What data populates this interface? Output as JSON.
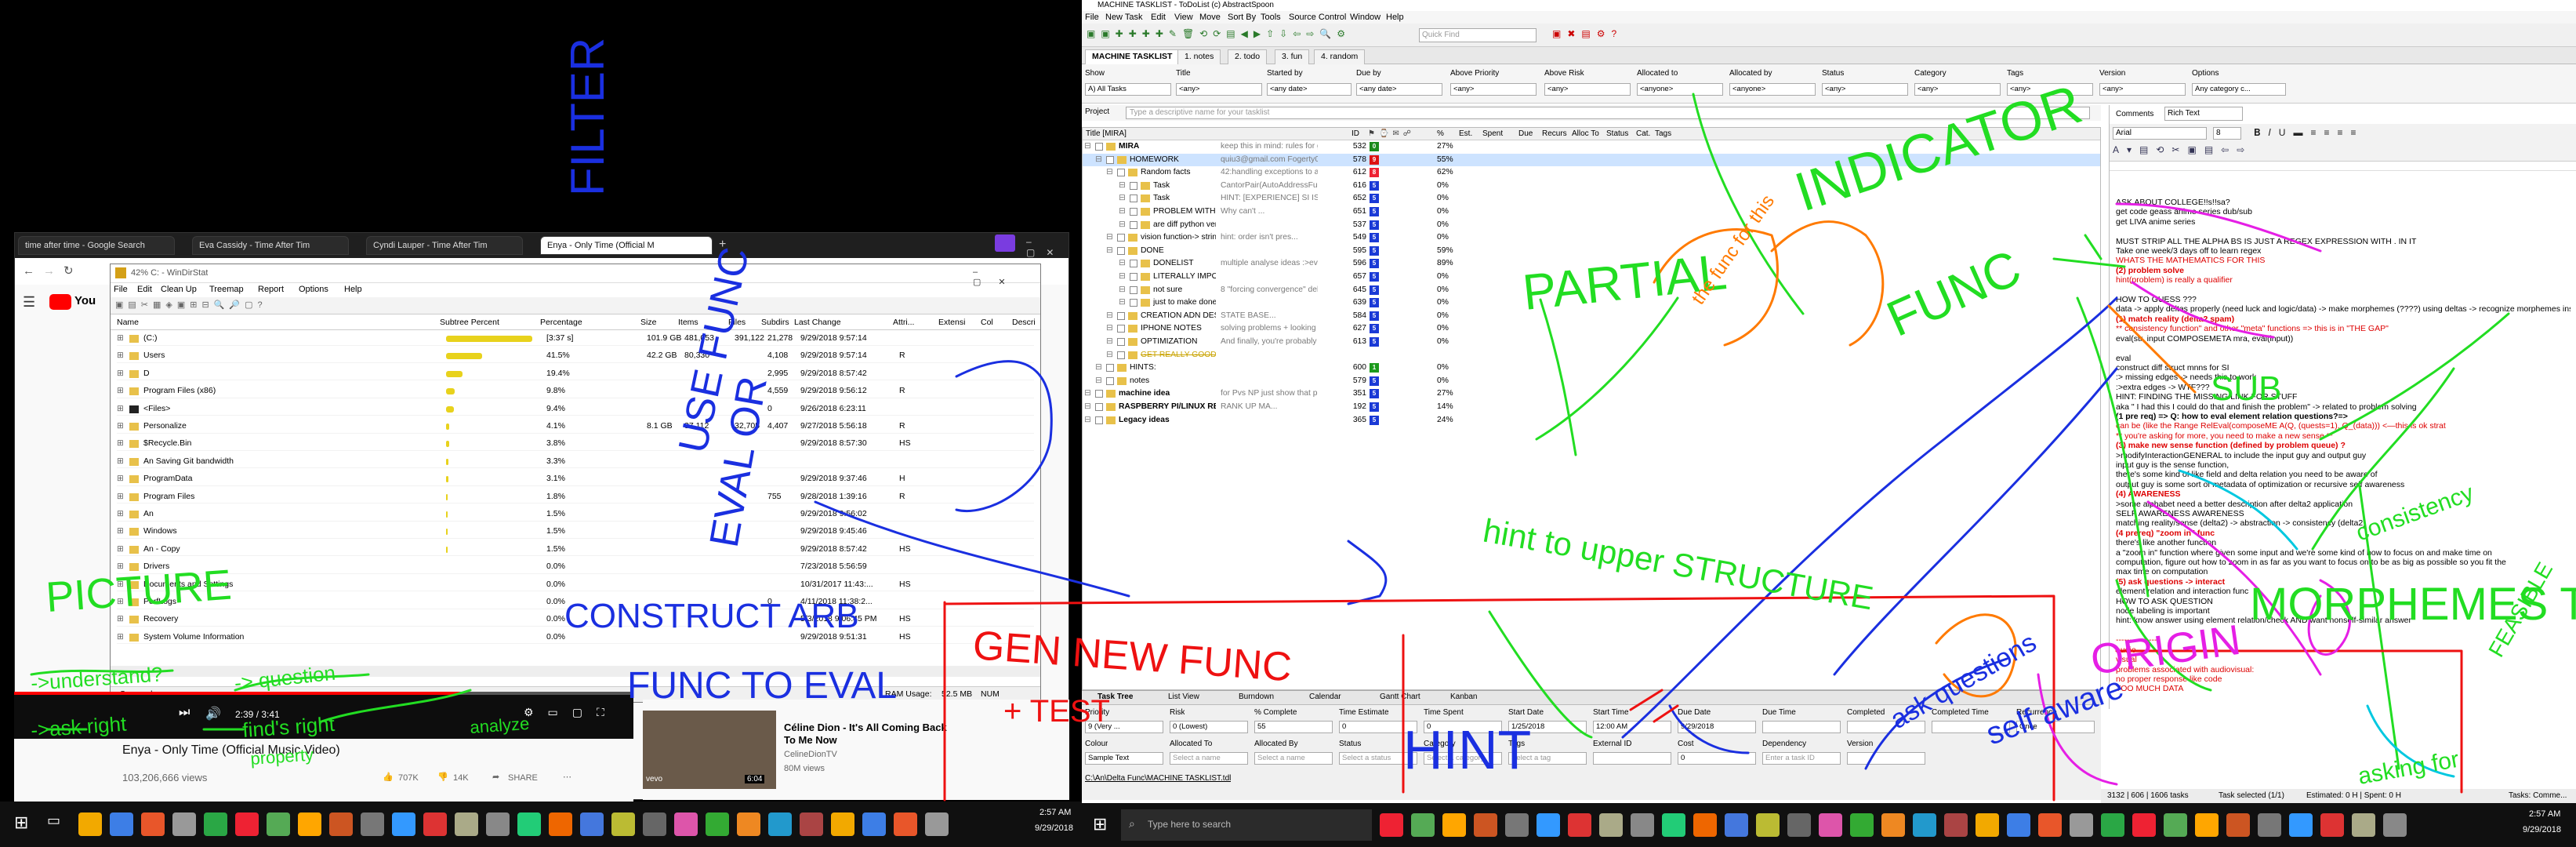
{
  "browser": {
    "tabs": [
      "time after time - Google Search",
      "Eva Cassidy - Time After Tim",
      "Cyndi Lauper - Time After Tim",
      "Enya - Only Time (Official M"
    ],
    "new_tab": "+"
  },
  "windirstat": {
    "title": "42% C: - WinDirStat",
    "menu": [
      "File",
      "Edit",
      "Clean Up",
      "Treemap",
      "Report",
      "Options",
      "Help"
    ],
    "columns": [
      "Name",
      "Subtree Percent",
      "Percentage",
      "Size",
      "Items",
      "Files",
      "Subdirs",
      "Last Change",
      "Attri...",
      "Extensi",
      "Col",
      "Descri"
    ],
    "rows": [
      {
        "name": "(C:)",
        "pct": "[3:37 s]",
        "size": "101.9 GB",
        "items": "481,053",
        "files": "391,122",
        "subdirs": "21,278",
        "change": "9/29/2018 9:57:14",
        "attr": ""
      },
      {
        "name": "Users",
        "pct": "41.5%",
        "size": "42.2 GB",
        "items": "80,330",
        "files": "",
        "subdirs": "4,108",
        "change": "9/29/2018 9:57:14",
        "attr": "R"
      },
      {
        "name": "D",
        "pct": "19.4%",
        "size": "",
        "items": "",
        "files": "",
        "subdirs": "2,995",
        "change": "9/29/2018 8:57:42",
        "attr": ""
      },
      {
        "name": "Program Files (x86)",
        "pct": "9.8%",
        "size": "",
        "items": "",
        "files": "",
        "subdirs": "4,559",
        "change": "9/29/2018 9:56:12",
        "attr": "R"
      },
      {
        "name": "<Files>",
        "pct": "9.4%",
        "size": "",
        "items": "",
        "files": "",
        "subdirs": "0",
        "change": "9/26/2018 6:23:11",
        "attr": ""
      },
      {
        "name": "Personalize",
        "pct": "4.1%",
        "size": "8.1 GB",
        "items": "37,112",
        "files": "32,705",
        "subdirs": "4,407",
        "change": "9/27/2018 5:56:18",
        "attr": "R"
      },
      {
        "name": "$Recycle.Bin",
        "pct": "3.8%",
        "size": "",
        "items": "",
        "files": "",
        "subdirs": "",
        "change": "9/29/2018 8:57:30",
        "attr": "HS"
      },
      {
        "name": "An Saving Git bandwidth",
        "pct": "3.3%",
        "size": "",
        "items": "",
        "files": "",
        "subdirs": "",
        "change": "",
        "attr": ""
      },
      {
        "name": "ProgramData",
        "pct": "3.1%",
        "size": "",
        "items": "",
        "files": "",
        "subdirs": "",
        "change": "9/29/2018 9:37:46",
        "attr": "H"
      },
      {
        "name": "Program Files",
        "pct": "1.8%",
        "size": "",
        "items": "",
        "files": "",
        "subdirs": "755",
        "change": "9/28/2018 1:39:16",
        "attr": "R"
      },
      {
        "name": "An",
        "pct": "1.5%",
        "size": "",
        "items": "",
        "files": "",
        "subdirs": "",
        "change": "9/29/2018 9:56:02",
        "attr": ""
      },
      {
        "name": "Windows",
        "pct": "1.5%",
        "size": "",
        "items": "",
        "files": "",
        "subdirs": "",
        "change": "9/29/2018 9:45:46",
        "attr": ""
      },
      {
        "name": "An - Copy",
        "pct": "1.5%",
        "size": "",
        "items": "",
        "files": "",
        "subdirs": "",
        "change": "9/29/2018 8:57:42",
        "attr": "HS"
      },
      {
        "name": "Drivers",
        "pct": "0.0%",
        "size": "",
        "items": "",
        "files": "",
        "subdirs": "",
        "change": "7/23/2018 5:56:59",
        "attr": ""
      },
      {
        "name": "Documents and Settings",
        "pct": "0.0%",
        "size": "",
        "items": "",
        "files": "",
        "subdirs": "",
        "change": "10/31/2017 11:43:...",
        "attr": "HS"
      },
      {
        "name": "PerfLogs",
        "pct": "0.0%",
        "size": "",
        "items": "",
        "files": "",
        "subdirs": "0",
        "change": "4/11/2018 11:38:2...",
        "attr": ""
      },
      {
        "name": "Recovery",
        "pct": "0.0%",
        "size": "",
        "items": "",
        "files": "",
        "subdirs": "",
        "change": "5/3/2018 9:06:45 PM",
        "attr": "HS"
      },
      {
        "name": "System Volume Information",
        "pct": "0.0%",
        "size": "",
        "items": "",
        "files": "",
        "subdirs": "",
        "change": "9/29/2018 9:51:31",
        "attr": "HS"
      }
    ],
    "status_left": "Suspend",
    "status_ram": "RAM Usage:",
    "status_ram_value": "52.5 MB",
    "status_num": "NUM"
  },
  "youtube": {
    "logo": "You",
    "time": "2:39 / 3:41",
    "title": "Enya - Only Time (Official Music Video)",
    "views": "103,206,666 views",
    "likes": "707K",
    "dislikes": "14K",
    "share": "SHARE",
    "side_title": "Céline Dion - It's All Coming Back To Me Now",
    "side_channel": "CelineDionTV",
    "side_views": "80M views",
    "side_duration": "6:04",
    "side_badge": "vevo"
  },
  "left_taskbar": {
    "clock_time": "2:57 AM",
    "clock_date": "9/29/2018"
  },
  "todolist": {
    "title": "MACHINE TASKLIST - ToDoList (c) AbstractSpoon",
    "menu": [
      "File",
      "New Task",
      "Edit",
      "View",
      "Move",
      "Sort By",
      "Tools",
      "Source Control",
      "Window",
      "Help"
    ],
    "quick_find": "Quick Find",
    "tabs": [
      "MACHINE TASKLIST",
      "1. notes",
      "2. todo",
      "3. fun",
      "4. random"
    ],
    "filters": [
      {
        "label": "Show",
        "value": "A) All Tasks"
      },
      {
        "label": "Title",
        "value": "<any>"
      },
      {
        "label": "Started by",
        "value": "<any date>"
      },
      {
        "label": "Due by",
        "value": "<any date>"
      },
      {
        "label": "Above Priority",
        "value": "<any>"
      },
      {
        "label": "Above Risk",
        "value": "<any>"
      },
      {
        "label": "Allocated to",
        "value": "<anyone>"
      },
      {
        "label": "Allocated by",
        "value": "<anyone>"
      },
      {
        "label": "Status",
        "value": "<any>"
      },
      {
        "label": "Category",
        "value": "<any>"
      },
      {
        "label": "Tags",
        "value": "<any>"
      },
      {
        "label": "Version",
        "value": "<any>"
      },
      {
        "label": "Options",
        "value": "Any category c..."
      }
    ],
    "project_label": "Project",
    "project_placeholder": "Type a descriptive name for your tasklist",
    "tree_header": "Title [MIRA]",
    "columns": [
      "ID",
      "%",
      "Est.",
      "Spent",
      "Due",
      "Recurs",
      "Alloc To",
      "Status",
      "Cat.",
      "Tags"
    ],
    "tasks": [
      {
        "title": "MIRA",
        "note": "keep this in mind: rules for graph representati...",
        "id": "532",
        "prio": "0",
        "pct": "27%",
        "indent": 0,
        "bold": true
      },
      {
        "title": "HOMEWORK",
        "note": "quiu3@gmail.com  Fogerty0   HOL...",
        "id": "578",
        "prio": "9",
        "pct": "55%",
        "indent": 1,
        "bold": false
      },
      {
        "title": "Random facts",
        "note": "42:handling exceptions to a fu...",
        "id": "612",
        "prio": "8",
        "pct": "62%",
        "indent": 2,
        "bold": false
      },
      {
        "title": "Task",
        "note": "CantorPair(AutoAddressFunc[][\"[ '...",
        "id": "616",
        "prio": "5",
        "pct": "0%",
        "indent": 3,
        "bold": false
      },
      {
        "title": "Task",
        "note": "HINT: [EXPERIENCE] SI IS MAPPIN...",
        "id": "652",
        "prio": "5",
        "pct": "0%",
        "indent": 3,
        "bold": false
      },
      {
        "title": "PROBLEM WITH DELTA2 HINT",
        "note": "Why can't ...",
        "id": "651",
        "prio": "5",
        "pct": "0%",
        "indent": 3,
        "bold": false
      },
      {
        "title": "are diff python versions going to be a probl",
        "note": "",
        "id": "537",
        "prio": "5",
        "pct": "0%",
        "indent": 3,
        "bold": false
      },
      {
        "title": "vision function-> string",
        "note": "hint: order isn't pres...",
        "id": "549",
        "prio": "5",
        "pct": "0%",
        "indent": 2,
        "bold": false
      },
      {
        "title": "DONE",
        "note": "",
        "id": "595",
        "prio": "5",
        "pct": "59%",
        "indent": 2,
        "bold": false
      },
      {
        "title": "DONELIST",
        "note": "multiple analyse ideas :>eva...",
        "id": "596",
        "prio": "5",
        "pct": "89%",
        "indent": 3,
        "bold": false
      },
      {
        "title": "LITERALLY IMPOSSIBLE OR SI DISGUISED",
        "note": "",
        "id": "657",
        "prio": "5",
        "pct": "0%",
        "indent": 3,
        "bold": false
      },
      {
        "title": "not sure",
        "note": "8 \"forcing convergence\" delta(...",
        "id": "645",
        "prio": "5",
        "pct": "0%",
        "indent": 3,
        "bold": false
      },
      {
        "title": "just to make done not cleared out",
        "note": "",
        "id": "639",
        "prio": "5",
        "pct": "0%",
        "indent": 3,
        "bold": false
      },
      {
        "title": "CREATION ADN DESTRUCTION",
        "note": "STATE BASE...",
        "id": "584",
        "prio": "5",
        "pct": "0%",
        "indent": 2,
        "bold": false
      },
      {
        "title": "IPHONE NOTES",
        "note": "solving problems + looking f...",
        "id": "627",
        "prio": "5",
        "pct": "0%",
        "indent": 2,
        "bold": false
      },
      {
        "title": "OPTIMIZATION",
        "note": "And finally, you're probably j...",
        "id": "613",
        "prio": "5",
        "pct": "0%",
        "indent": 2,
        "bold": false
      },
      {
        "title": "GET REALLY GOOD FUCKING SLEEP TO JUST P...",
        "note": "",
        "id": "",
        "prio": "",
        "pct": "",
        "indent": 2,
        "bold": false
      },
      {
        "title": "HINTS:",
        "note": "",
        "id": "600",
        "prio": "1",
        "pct": "0%",
        "indent": 1,
        "bold": false
      },
      {
        "title": "notes",
        "note": "",
        "id": "579",
        "prio": "5",
        "pct": "0%",
        "indent": 1,
        "bold": false
      },
      {
        "title": "machine idea",
        "note": "for Pvs NP just show that p bar sub...",
        "id": "351",
        "prio": "5",
        "pct": "27%",
        "indent": 0,
        "bold": true
      },
      {
        "title": "RASPBERRY PI/LINUX REFERENCE",
        "note": "RANK UP MA...",
        "id": "192",
        "prio": "5",
        "pct": "14%",
        "indent": 0,
        "bold": true
      },
      {
        "title": "Legacy ideas",
        "note": "",
        "id": "365",
        "prio": "5",
        "pct": "24%",
        "indent": 0,
        "bold": true
      }
    ],
    "comments_label": "Comments",
    "comments_format": "Rich Text",
    "font": "Arial",
    "font_size": "8",
    "comment_lines": [
      "ASK ABOUT COLLEGE!!s!!sa?",
      "get code geass anime series dub/sub",
      "get LIVA anime series",
      "",
      "MUST STRIP ALL THE ALPHA BS IS JUST A REGEX EXPRESSION WITH . IN IT",
      "Take one week/3 days off to learn regex",
      "WHATS THE MATHEMATICS FOR THIS",
      "(2) problem solve",
      "     hint(problem) is really a qualifier",
      "",
      "HOW TO GUESS ???",
      "data -> apply deltas properly (need luck and logic/data) -> make morphemes (????) using deltas -> recognize morphemes instead",
      "(1) match reality (delta2 spam)",
      "     ** consistency function\" and other \"meta\" functions => this is in \"THE GAP\"",
      "     eval(str, input COMPOSEMETA mra, eval(input))",
      "",
      "eval",
      "construct diff struct mnns for SI",
      ":> missing edges -> needs this to work",
      ":>extra edges -> WTF???",
      "HINT: FINDING THE MISSING LINK FOR STUFF",
      "aka \" I had this I could do that and finish the problem\" -> related to problem solving",
      "(1 pre req) => Q: how to eval element relation questions?=>",
      "     can be (like the Range      RelEval(composeME A(Q, (quests=1), Q_(data)))    <—this is ok strat",
      "     ** you're asking for more, you need to make a new sense **",
      "(3) make new sense function (defined by problem queue) ?",
      ">modifyInteractionGENERAL to include the input guy and output guy",
      "input guy is the sense function,",
      "there's some kind of like field and delta relation you need to be aware of",
      "output guy is some sort of metadata of optimization or recursive self awareness",
      "(4) AWARENESS",
      "     >some alphabet need a better description after delta2 application",
      "     SELF AWARENESS AWARENESS",
      "     matching reality/sense (delta2) -> abstraction -> consistency (delta2)",
      "(4 prereq) \"zoom in\" func",
      "     there's like another function",
      "     a \"zoom in\" function where given some input and we're some kind of how to focus on and make time on",
      "     computation, figure out how to zoom in as far as you want to focus on to be as big as possible so you fit the",
      "     max time on computation",
      "(5) ask questions -> interact",
      "     element relation and interaction func",
      "     HOW TO ASK QUESTION",
      "     node labeling is important",
      "     hint: know answer using element relation/check AND want nonself-similar answer",
      "",
      "---------------",
      "audio",
      "visual",
      "problems associated with audiovisual:",
      "     no proper response like code",
      "     TOO MUCH DATA"
    ],
    "attr_tabs": [
      "Task Tree",
      "List View",
      "Burndown",
      "Calendar",
      "Gantt Chart",
      "Kanban"
    ],
    "attr_fields": [
      {
        "label": "Priority",
        "value": "9 (Very ..."
      },
      {
        "label": "Risk",
        "value": "0 (Lowest)"
      },
      {
        "label": "% Complete",
        "value": "55"
      },
      {
        "label": "Time Estimate",
        "value": "0"
      },
      {
        "label": "Time Spent",
        "value": "0"
      },
      {
        "label": "Start Date",
        "value": "1/25/2018"
      },
      {
        "label": "Start Time",
        "value": "12:00 AM"
      },
      {
        "label": "Due Date",
        "value": "9/29/2018"
      },
      {
        "label": "Due Time",
        "value": ""
      },
      {
        "label": "Completed",
        "value": ""
      },
      {
        "label": "Completed Time",
        "value": ""
      },
      {
        "label": "Recurrence",
        "value": "Once"
      }
    ],
    "attr_fields2": [
      {
        "label": "Colour",
        "value": "Sample Text"
      },
      {
        "label": "Allocated To",
        "value": "Select a name"
      },
      {
        "label": "Allocated By",
        "value": "Select a name"
      },
      {
        "label": "Status",
        "value": "Select a status"
      },
      {
        "label": "Category",
        "value": "Select a category"
      },
      {
        "label": "Tags",
        "value": "Select a tag"
      },
      {
        "label": "External ID",
        "value": ""
      },
      {
        "label": "Cost",
        "value": "0"
      },
      {
        "label": "Dependency",
        "value": "Enter a task ID"
      },
      {
        "label": "Version",
        "value": ""
      }
    ],
    "file_link": "C:\\An\\Delta Func\\MACHINE TASKLIST.tdl",
    "status_text": "3132 | 606 | 1606 tasks",
    "status_sel": "Task selected (1/1)",
    "status_info": "Estimated: 0 H | Spent: 0 H",
    "status_tasks": "Tasks: Comme..."
  },
  "right_taskbar": {
    "search": "Type here to search",
    "clock_time": "2:57 AM",
    "clock_date": "9/29/2018"
  },
  "annotations": [
    "PARTIAL",
    "INDICATOR",
    "FUNC",
    "the func for this",
    "SUB",
    "consistency",
    "MORPHEMES TIME",
    "FEASIBLE",
    "hint to upper STRUCTURE",
    "ORIGIN",
    "GEN NEW FUNC",
    "+ TEST",
    "HINT",
    "ask questions",
    "self aware",
    "asking for",
    "FILTER",
    "USE FUNC",
    "EVAL OR",
    "CONSTRUCT ARB",
    "FUNC TO EVAL",
    "PICTURE",
    "->understand?",
    "-> question",
    "->ask right",
    "find's right",
    "analyze",
    "property"
  ],
  "ink_colors": {
    "green": "#22dd22",
    "blue": "#1a2fe0",
    "red": "#ee1111",
    "orange": "#ff7a00",
    "magenta": "#e51fe5",
    "cyan": "#00c8e0"
  }
}
